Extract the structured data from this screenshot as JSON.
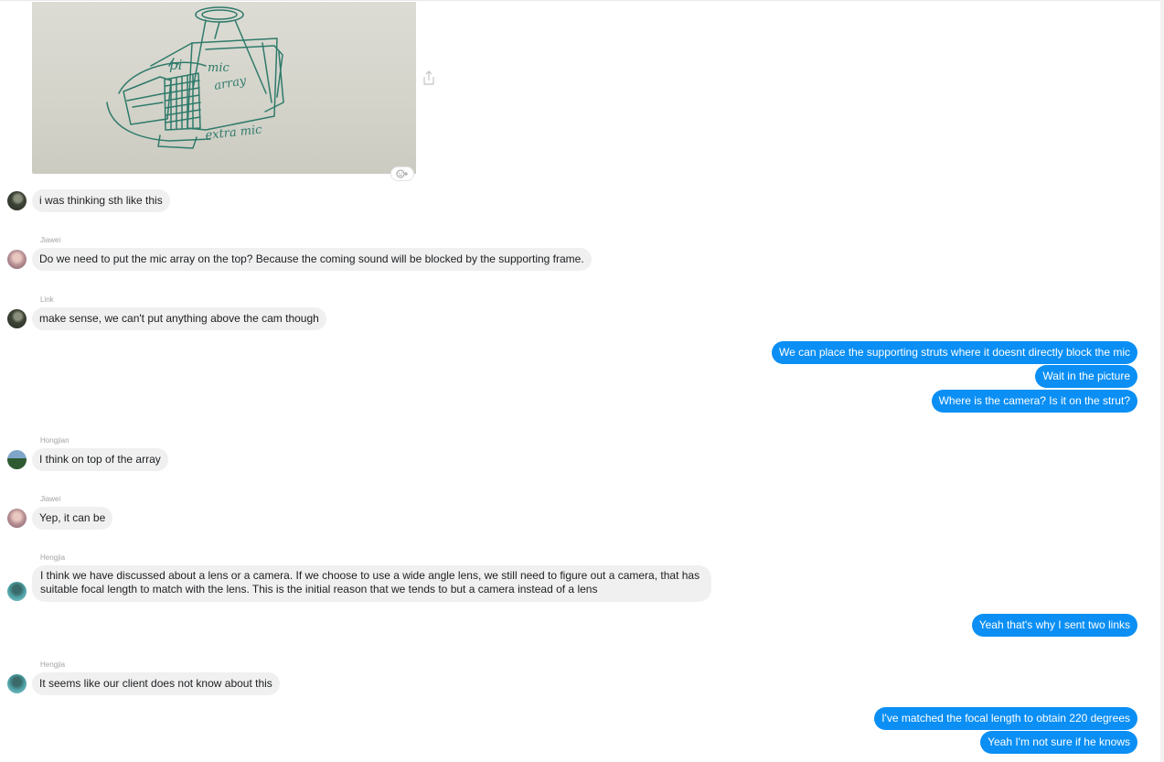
{
  "image_attachment": {
    "sketch_labels": {
      "pi": "pi",
      "mic": "mic",
      "array": "array",
      "extra_mic": "extra mic"
    }
  },
  "icons": {
    "share": "share-icon",
    "reaction": "add-reaction-icon"
  },
  "colors": {
    "outgoing_bubble": "#0b8ff4",
    "incoming_bubble": "#f0f0f0"
  },
  "messages": [
    {
      "direction": "in",
      "text": "i was thinking sth like this"
    },
    {
      "direction": "in",
      "sender": "Jiawei",
      "text": "Do we need to put the mic array on the top? Because the coming sound will be blocked by the supporting frame."
    },
    {
      "direction": "in",
      "sender": "Link",
      "text": "make sense, we can't put anything above the cam though"
    },
    {
      "direction": "out",
      "text": "We can place the supporting struts where it doesnt directly block the mic"
    },
    {
      "direction": "out",
      "text": "Wait in the picture"
    },
    {
      "direction": "out",
      "text": "Where is the camera? Is it on the strut?"
    },
    {
      "direction": "in",
      "sender": "Hongjian",
      "text": "I think on top of the array"
    },
    {
      "direction": "in",
      "sender": "Jiawei",
      "text": "Yep, it can be"
    },
    {
      "direction": "in",
      "sender": "Hengjia",
      "text": "I think we have discussed about a lens or a camera. If we choose to use a wide angle lens, we still need to figure out a camera, that has suitable focal length to match with the lens. This is the initial reason that we tends to but a camera instead of a lens"
    },
    {
      "direction": "out",
      "text": "Yeah that's why I sent two links"
    },
    {
      "direction": "in",
      "sender": "Hengjia",
      "text": "It seems like our client does not know about this"
    },
    {
      "direction": "out",
      "text": "I've matched the focal length to obtain 220 degrees"
    },
    {
      "direction": "out",
      "text": "Yeah I'm not sure if he knows"
    }
  ]
}
